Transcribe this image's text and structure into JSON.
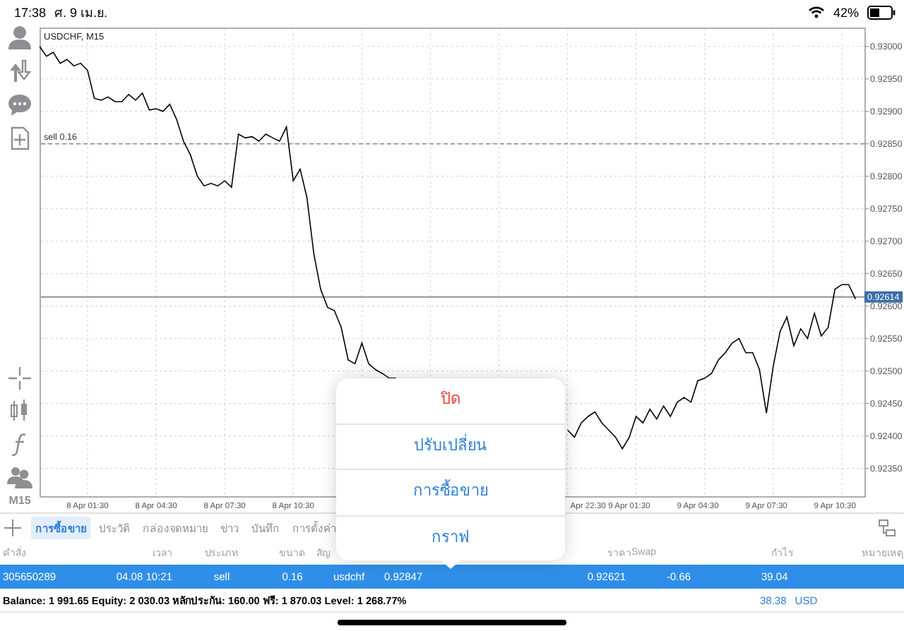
{
  "status_bar": {
    "time": "17:38",
    "date": "ศ. 9 เม.ย.",
    "battery": "42%"
  },
  "toolbar": {
    "timeframe": "M15"
  },
  "chart": {
    "symbol_label": "USDCHF, M15",
    "chart_data": {
      "type": "line",
      "categories": [
        null,
        null,
        null,
        null,
        null,
        null,
        null,
        "8 Apr 01:30",
        null,
        null,
        null,
        null,
        null,
        null,
        null,
        null,
        null,
        "8 Apr 04:30",
        null,
        null,
        null,
        null,
        null,
        null,
        null,
        null,
        null,
        "8 Apr 07:30",
        null,
        null,
        null,
        null,
        null,
        null,
        null,
        null,
        null,
        "8 Apr 10:30",
        null,
        null,
        null,
        null,
        null,
        null,
        null,
        null,
        null,
        null,
        null,
        null,
        null,
        null,
        null,
        null,
        null,
        null,
        null,
        null,
        null,
        null,
        null,
        null,
        null,
        null,
        null,
        null,
        null,
        null,
        null,
        null,
        null,
        null,
        null,
        null,
        null,
        null,
        null,
        null,
        null,
        null,
        "Apr 22:30",
        null,
        null,
        null,
        null,
        null,
        "9 Apr 01:30",
        null,
        null,
        null,
        null,
        null,
        null,
        null,
        null,
        null,
        "9 Apr 04:30",
        null,
        null,
        null,
        null,
        null,
        null,
        null,
        null,
        null,
        "9 Apr 07:30",
        null,
        null,
        null,
        null,
        null,
        null,
        null,
        null,
        null,
        "9 Apr 10:30",
        null,
        null,
        null
      ],
      "series": [
        {
          "color": "#000000",
          "values": [
            0.93,
            0.92985,
            0.92991,
            0.92974,
            0.9298,
            0.9297,
            0.92974,
            0.92963,
            0.9292,
            0.92917,
            0.92922,
            0.92915,
            0.92915,
            0.92926,
            0.92917,
            0.92928,
            0.92902,
            0.92904,
            0.929,
            0.92911,
            0.92887,
            0.92854,
            0.92833,
            0.928,
            0.92785,
            0.92789,
            0.92785,
            0.92793,
            0.92783,
            0.92865,
            0.92859,
            0.92861,
            0.92854,
            0.92865,
            0.92859,
            0.92854,
            0.92876,
            0.92793,
            0.92811,
            0.92767,
            0.9268,
            0.92626,
            0.92598,
            0.92593,
            0.92567,
            0.92517,
            0.92511,
            0.92543,
            0.92511,
            0.92502,
            0.92496,
            0.92489,
            0.92489,
            null,
            null,
            null,
            null,
            null,
            null,
            null,
            null,
            null,
            null,
            null,
            null,
            null,
            null,
            null,
            null,
            null,
            null,
            null,
            null,
            null,
            null,
            null,
            null,
            0.92409,
            0.92398,
            0.9242,
            0.9243,
            0.92437,
            0.9242,
            0.92409,
            0.92398,
            0.9238,
            0.92398,
            0.9243,
            0.9242,
            0.92441,
            0.92426,
            0.92446,
            0.9243,
            0.92452,
            0.92459,
            0.92452,
            0.92485,
            0.92489,
            0.92496,
            0.92517,
            0.92528,
            0.92543,
            0.9255,
            0.92528,
            0.92528,
            0.92502,
            0.92435,
            0.92507,
            0.92561,
            0.92583,
            0.92539,
            0.92565,
            0.9255,
            0.92589,
            0.92554,
            0.92567,
            0.92626,
            0.92633,
            0.92633,
            0.92611
          ]
        }
      ],
      "ylim": [
        0.92306,
        0.93028
      ],
      "yticks": [
        {
          "value": 0.93,
          "label": "0.93000"
        },
        {
          "value": 0.9295,
          "label": "0.92950"
        },
        {
          "value": 0.929,
          "label": "0.92900"
        },
        {
          "value": 0.9285,
          "label": "0.92850"
        },
        {
          "value": 0.928,
          "label": "0.92800"
        },
        {
          "value": 0.9275,
          "label": "0.92750"
        },
        {
          "value": 0.927,
          "label": "0.92700"
        },
        {
          "value": 0.9265,
          "label": "0.92650"
        },
        {
          "value": 0.926,
          "label": "0.92600"
        },
        {
          "value": 0.9255,
          "label": "0.92550"
        },
        {
          "value": 0.925,
          "label": "0.92500"
        },
        {
          "value": 0.9245,
          "label": "0.92450"
        },
        {
          "value": 0.924,
          "label": "0.92400"
        },
        {
          "value": 0.9235,
          "label": "0.92350"
        }
      ],
      "grid": true,
      "ref_lines": [
        {
          "axis": "y",
          "value": 0.9285,
          "label": "sell 0.16"
        },
        {
          "axis": "y",
          "value": 0.92614,
          "label": "0.92614"
        }
      ]
    }
  },
  "tabs": [
    {
      "label": "การซื้อขาย",
      "selected": true
    },
    {
      "label": "ประวัติ",
      "selected": false
    },
    {
      "label": "กล่องจดหมาย",
      "selected": false
    },
    {
      "label": "ข่าว",
      "selected": false
    },
    {
      "label": "บันทึก",
      "selected": false
    },
    {
      "label": "การตั้งค่า",
      "selected": false
    }
  ],
  "table": {
    "columns": [
      "คำสั่ง",
      "เวลา",
      "ประเภท",
      "ขนาด",
      "สัญ",
      "",
      "",
      "",
      "ราคา",
      "Swap",
      "กำไร",
      "หมายเหตุ"
    ],
    "rows": [
      {
        "selected": true,
        "cells": [
          "305650289",
          "04.08 10:21",
          "sell",
          "0.16",
          "usdchf",
          "0.92847",
          "",
          "",
          "0.92621",
          "-0.66",
          "39.04",
          ""
        ]
      }
    ]
  },
  "account": {
    "summary": "Balance: 1 991.65 Equity: 2 030.03 หลักประกัน: 160.00 ฟรี: 1 870.03 Level: 1 268.77%",
    "total": "38.38",
    "currency": "USD"
  },
  "menu": {
    "items": [
      {
        "label": "ปิด",
        "kind": "destructive"
      },
      {
        "label": "ปรับเปลี่ยน",
        "kind": "default"
      },
      {
        "label": "การซื้อขาย",
        "kind": "default"
      },
      {
        "label": "กราฟ",
        "kind": "default"
      }
    ]
  }
}
